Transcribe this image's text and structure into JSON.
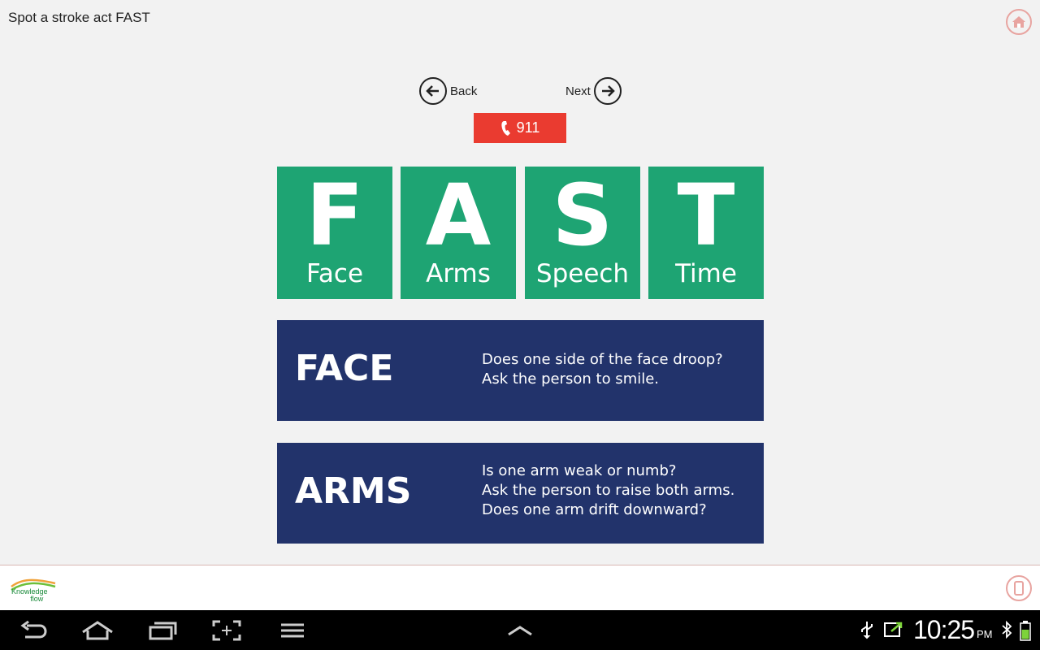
{
  "app": {
    "title": "Spot a stroke act FAST"
  },
  "nav": {
    "back_label": "Back",
    "next_label": "Next"
  },
  "call": {
    "label": "911"
  },
  "tiles": [
    {
      "letter": "F",
      "word": "Face"
    },
    {
      "letter": "A",
      "word": "Arms"
    },
    {
      "letter": "S",
      "word": "Speech"
    },
    {
      "letter": "T",
      "word": "Time"
    }
  ],
  "cards": [
    {
      "heading": "FACE",
      "lines": [
        "Does one side of the face droop?",
        "Ask the person to smile."
      ]
    },
    {
      "heading": "ARMS",
      "lines": [
        "Is one arm weak or numb?",
        "Ask the person to raise both arms.",
        "Does one arm drift downward?"
      ]
    }
  ],
  "footer": {
    "logo_line1": "Knowledge",
    "logo_line2": "flow"
  },
  "status": {
    "time": "10:25",
    "ampm": "PM"
  },
  "colors": {
    "tile_green": "#1ea473",
    "card_navy": "#22336b",
    "call_red": "#ea3b30",
    "accent_pink": "#e8a4a0"
  },
  "icons": [
    "home-icon",
    "back-arrow-icon",
    "next-arrow-icon",
    "phone-icon",
    "device-icon",
    "nav-back-icon",
    "nav-home-icon",
    "recent-apps-icon",
    "screenshot-icon",
    "menu-icon",
    "chevron-up-icon",
    "usb-icon",
    "sync-icon",
    "bluetooth-icon",
    "battery-icon"
  ]
}
